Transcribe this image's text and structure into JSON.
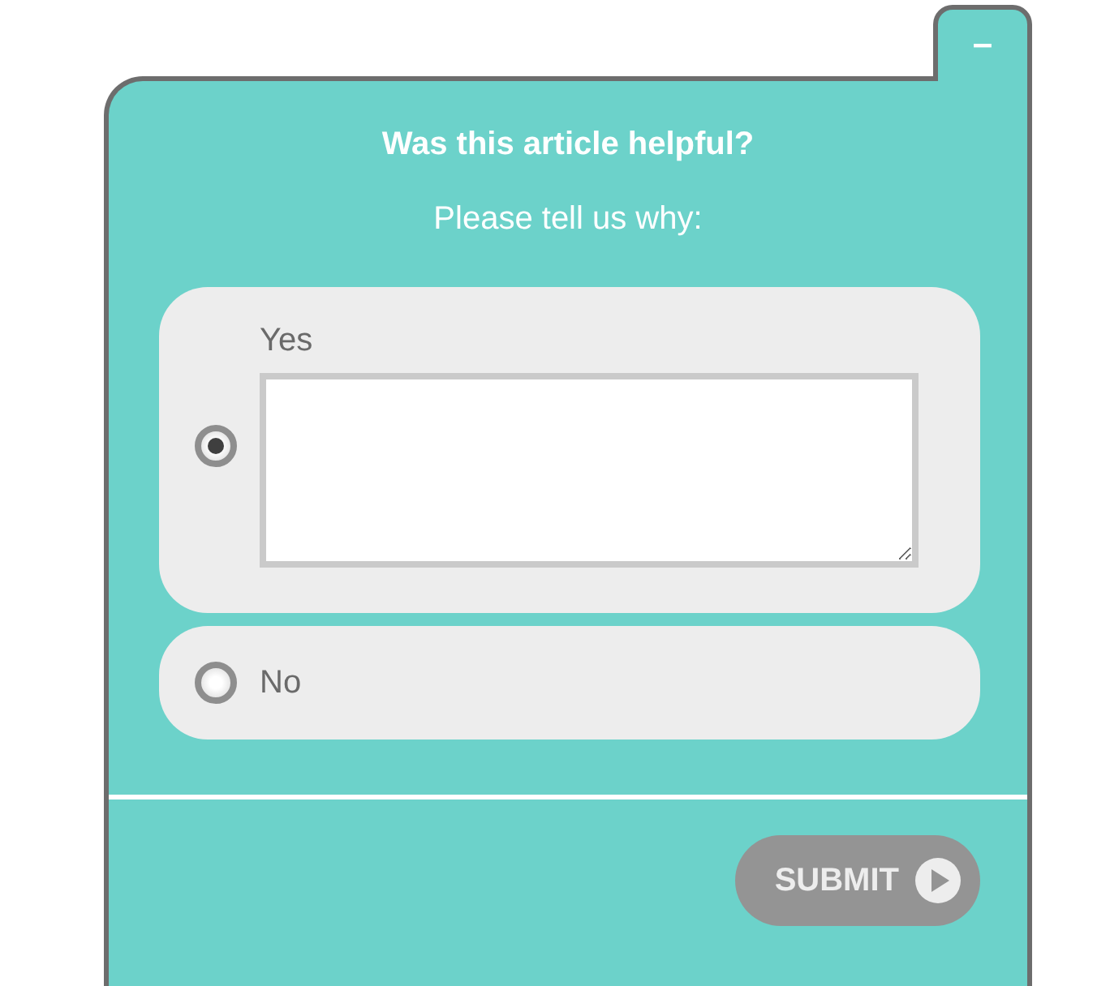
{
  "minimize_button": {
    "label": "–"
  },
  "title": "Was this article helpful?",
  "subtitle": "Please tell us why:",
  "options": [
    {
      "label": "Yes",
      "selected": true
    },
    {
      "label": "No",
      "selected": false
    }
  ],
  "submit_button": {
    "label": "SUBMIT"
  }
}
